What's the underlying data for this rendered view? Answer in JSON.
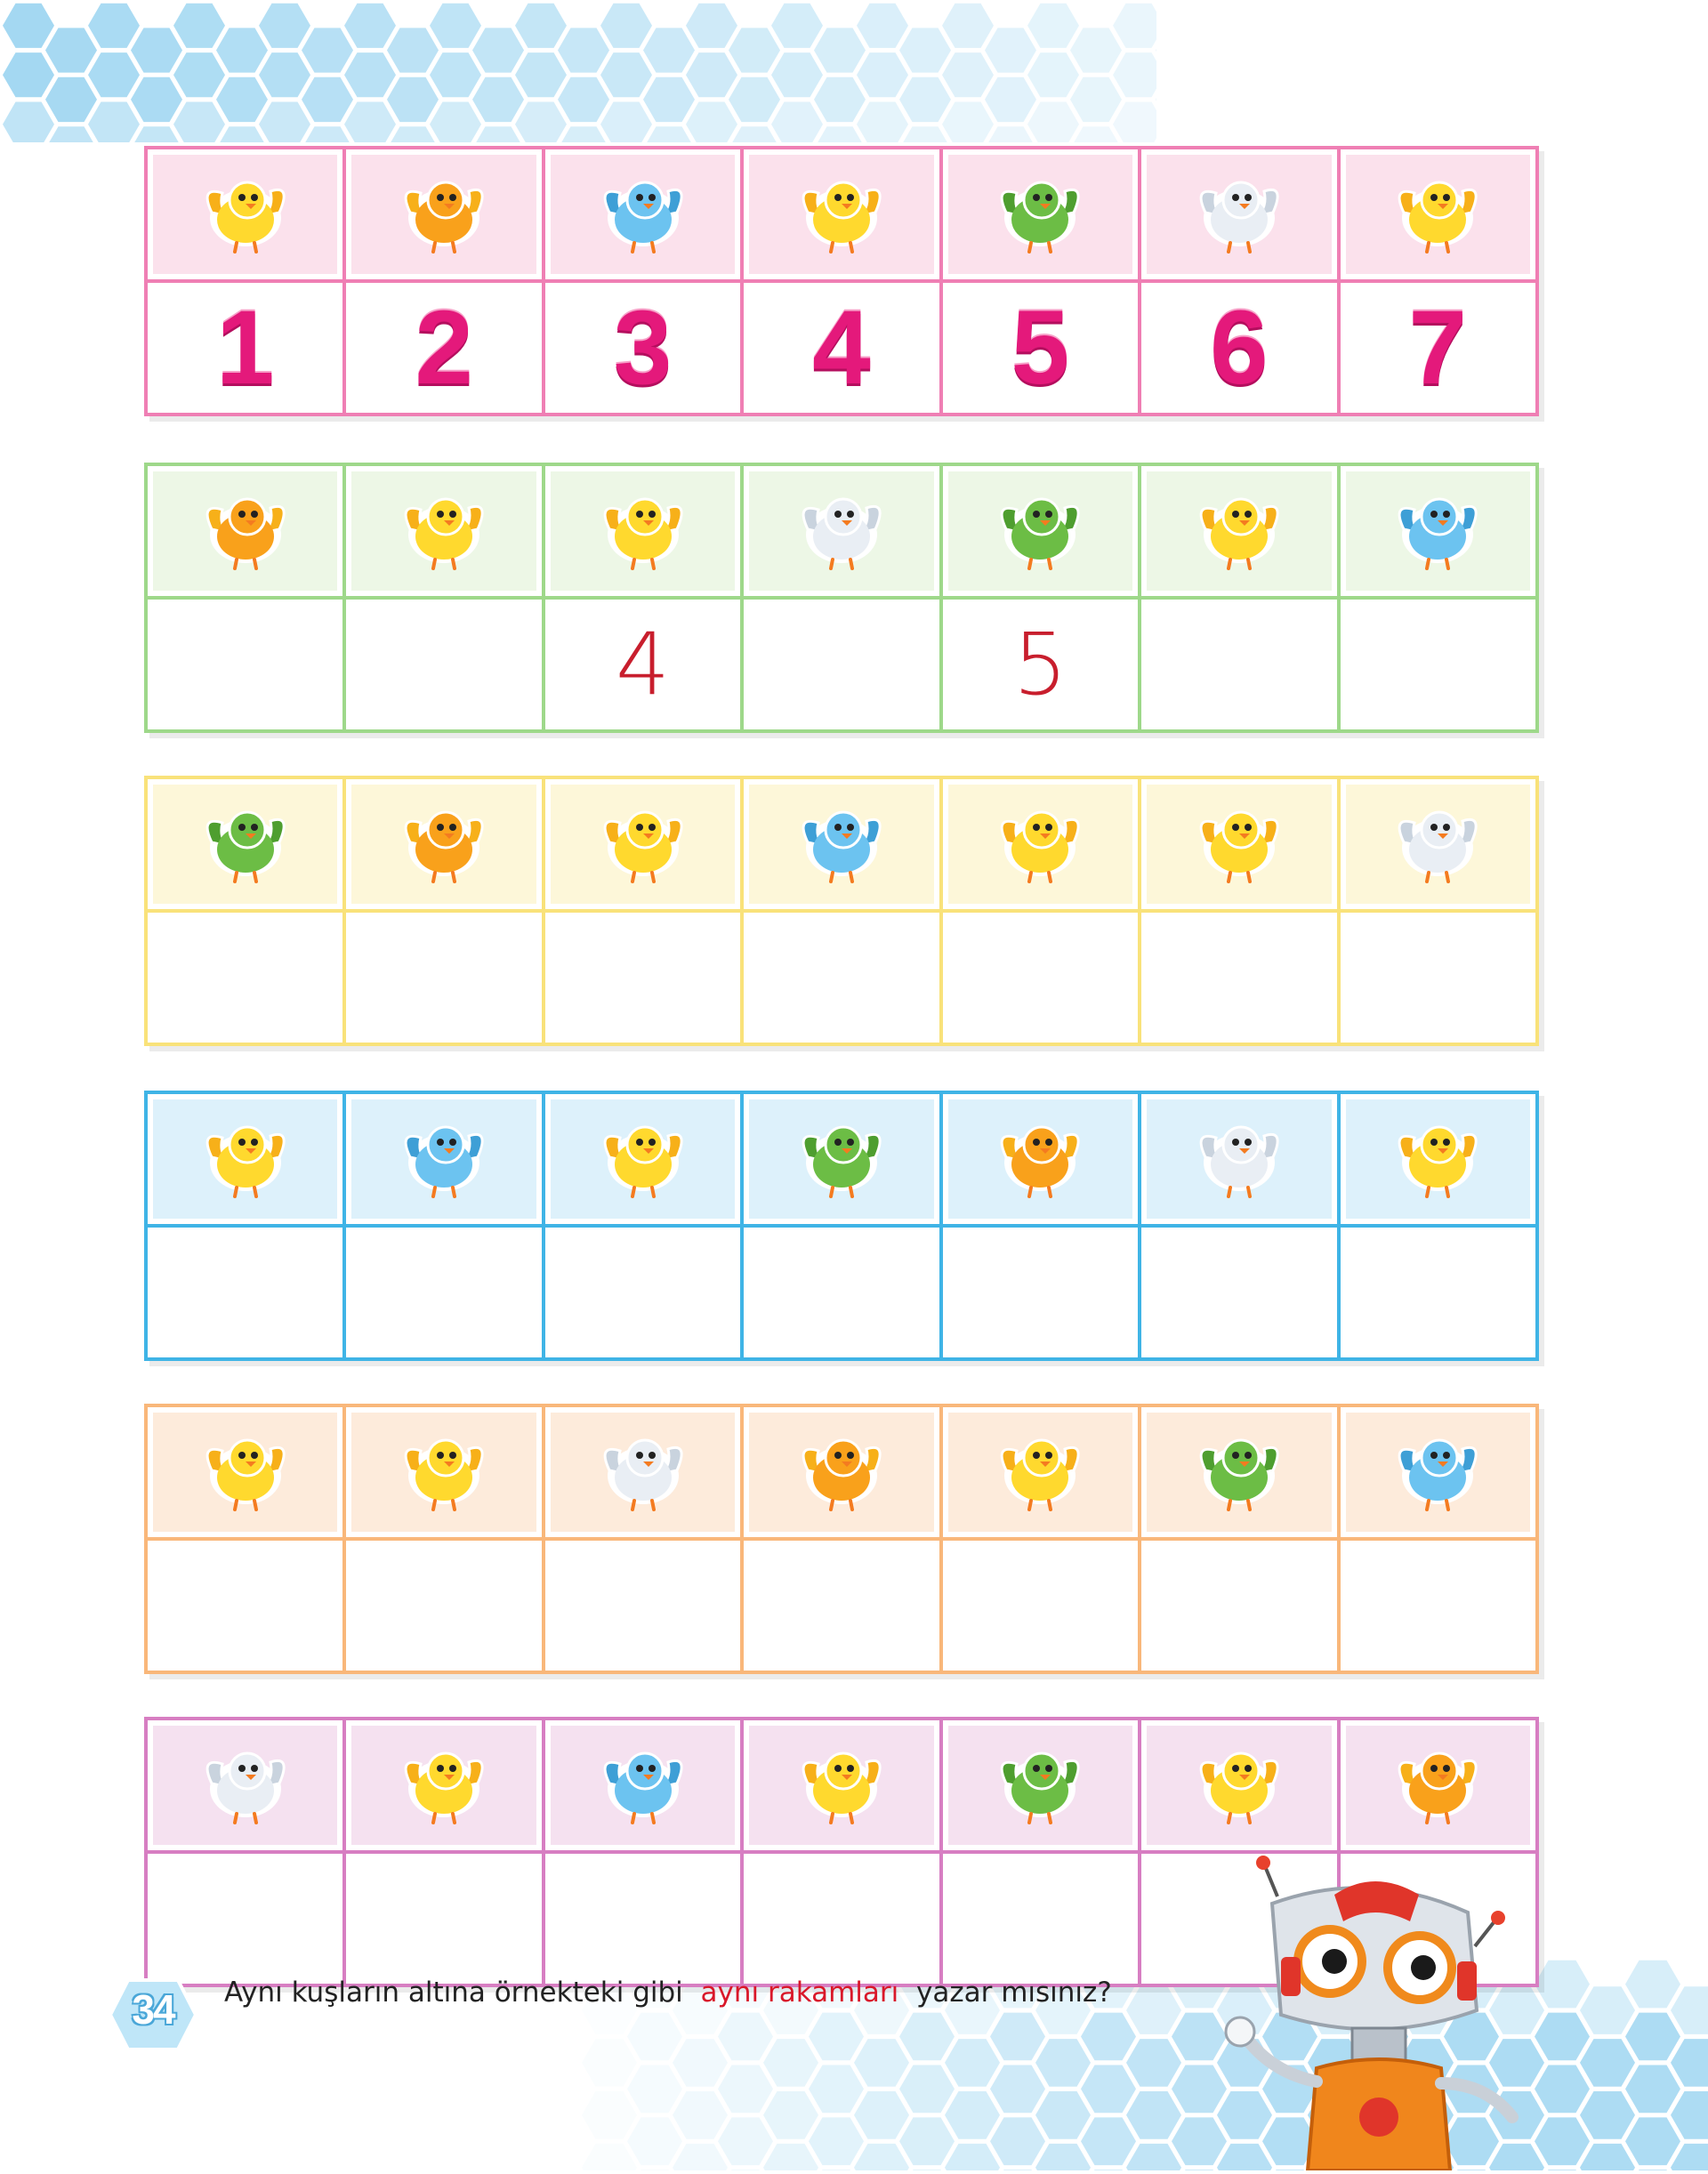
{
  "page": {
    "instruction_part1": "Aynı kuşların altına örnekteki gibi",
    "instruction_highlight": "aynı rakamları",
    "instruction_part2": "yazar mısınız?",
    "page_number": "34"
  },
  "rows": [
    {
      "theme": "pink",
      "border": "#ef7fb4",
      "bg": "#fbe1ec",
      "birds": [
        "yellow-flying-bird",
        "orange-bird",
        "blue-bird",
        "yellow-standing-bird",
        "green-bird",
        "white-bird",
        "yellow-chick"
      ],
      "answers": [
        "1",
        "2",
        "3",
        "4",
        "5",
        "6",
        "7"
      ],
      "answer_style": "example"
    },
    {
      "theme": "green",
      "border": "#9ed88a",
      "bg": "#edf7e6",
      "birds": [
        "orange-bird",
        "yellow-chick",
        "yellow-standing-bird",
        "white-bird",
        "green-bird",
        "yellow-flying-bird",
        "blue-bird"
      ],
      "answers": [
        "",
        "",
        "4",
        "",
        "5",
        "",
        ""
      ],
      "answer_style": "handwritten"
    },
    {
      "theme": "yellow",
      "border": "#f9e27a",
      "bg": "#fdf7d9",
      "birds": [
        "green-bird",
        "orange-bird",
        "yellow-chick",
        "blue-bird",
        "yellow-flying-bird",
        "yellow-standing-bird",
        "white-bird"
      ],
      "answers": [
        "",
        "",
        "",
        "",
        "",
        "",
        ""
      ],
      "answer_style": "handwritten"
    },
    {
      "theme": "blue",
      "border": "#3fb4e6",
      "bg": "#ddf1fb",
      "birds": [
        "yellow-chick",
        "blue-bird",
        "yellow-flying-bird",
        "green-bird",
        "orange-bird",
        "white-bird",
        "yellow-standing-bird"
      ],
      "answers": [
        "",
        "",
        "",
        "",
        "",
        "",
        ""
      ],
      "answer_style": "handwritten"
    },
    {
      "theme": "orange",
      "border": "#f9b77a",
      "bg": "#fdebdb",
      "birds": [
        "yellow-standing-bird",
        "yellow-flying-bird",
        "white-bird",
        "orange-bird",
        "yellow-chick",
        "green-bird",
        "blue-bird"
      ],
      "answers": [
        "",
        "",
        "",
        "",
        "",
        "",
        ""
      ],
      "answer_style": "handwritten"
    },
    {
      "theme": "purple",
      "border": "#d77ec2",
      "bg": "#f5e1f0",
      "birds": [
        "white-bird",
        "yellow-standing-bird",
        "blue-bird",
        "yellow-flying-bird",
        "green-bird",
        "yellow-chick",
        "orange-bird"
      ],
      "answers": [
        "",
        "",
        "",
        "",
        "",
        "",
        ""
      ],
      "answer_style": "handwritten"
    }
  ],
  "bird_colors": {
    "yellow-flying-bird": "#ffd92e",
    "orange-bird": "#f9a11b",
    "blue-bird": "#6cc3f0",
    "yellow-standing-bird": "#ffd92e",
    "green-bird": "#6cbd45",
    "white-bird": "#e9eef4",
    "yellow-chick": "#ffd92e"
  }
}
